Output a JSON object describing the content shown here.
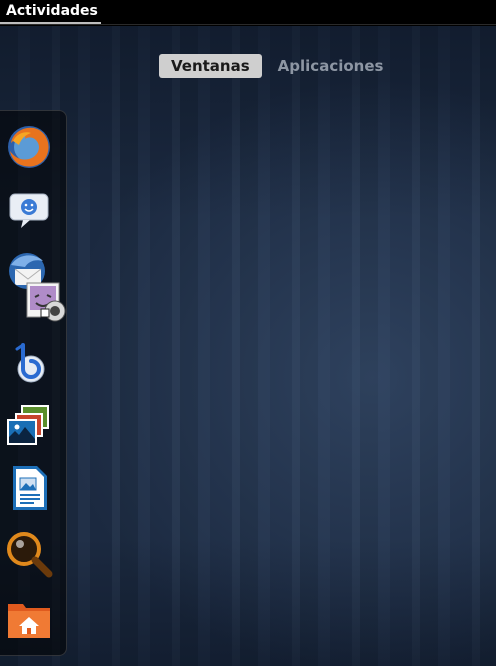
{
  "top_panel": {
    "activities_label": "Actividades"
  },
  "view_selector": {
    "tabs": [
      {
        "label": "Ventanas",
        "active": true
      },
      {
        "label": "Aplicaciones",
        "active": false
      }
    ]
  },
  "dash": {
    "items": [
      {
        "icon": "firefox-icon"
      },
      {
        "icon": "empathy-chat-icon"
      },
      {
        "icon": "thunderbird-icon"
      },
      {
        "icon": "cheese-webcam-icon"
      },
      {
        "icon": "banshee-music-icon"
      },
      {
        "icon": "shotwell-photos-icon"
      },
      {
        "icon": "libreoffice-writer-icon"
      },
      {
        "icon": "search-magnifier-icon"
      },
      {
        "icon": "home-folder-icon"
      }
    ]
  },
  "colors": {
    "panel": "#000000",
    "wallpaper": "#1d2c44",
    "active_tab": "#cfcfcf",
    "inactive_tab_text": "#8d96a3"
  }
}
